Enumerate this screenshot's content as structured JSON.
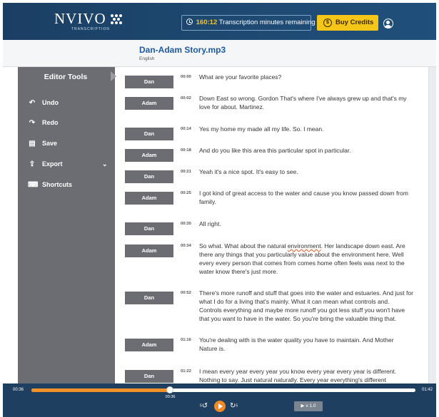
{
  "header": {
    "logo_text": "NVIVO",
    "logo_sub": "TRANSCRIPTION",
    "minutes_value": "160:12",
    "minutes_label": "Transcription minutes remaining",
    "buy_label": "Buy Credits"
  },
  "file": {
    "name": "Dan-Adam Story.mp3",
    "language": "English"
  },
  "sidebar": {
    "title": "Editor Tools",
    "tools": [
      {
        "label": "Undo",
        "icon": "undo-icon",
        "glyph": "↶"
      },
      {
        "label": "Redo",
        "icon": "redo-icon",
        "glyph": "↷"
      },
      {
        "label": "Save",
        "icon": "save-icon",
        "glyph": "▤"
      },
      {
        "label": "Export",
        "icon": "export-icon",
        "glyph": "⇪"
      },
      {
        "label": "Shortcuts",
        "icon": "keyboard-icon",
        "glyph": "⌨"
      }
    ]
  },
  "transcript": [
    {
      "speaker": "Dan",
      "time": "00:00",
      "text": "What are your favorite places?"
    },
    {
      "speaker": "Adam",
      "time": "00:02",
      "text": "Down East so wrong. Gordon That's where I've always grew up and that's my love for about. Martinez."
    },
    {
      "speaker": "Dan",
      "time": "00:14",
      "text": "Yes my home my made all my life. So. I mean."
    },
    {
      "speaker": "Adam",
      "time": "00:18",
      "text": "And do you like this area this particular spot in particular."
    },
    {
      "speaker": "Dan",
      "time": "00:21",
      "text": "Yeah it's a nice spot. It's easy to see."
    },
    {
      "speaker": "Adam",
      "time": "00:25",
      "text": "I got kind of great access to the water and cause you know passed down from family."
    },
    {
      "speaker": "Dan",
      "time": "00:30",
      "text": "All right."
    },
    {
      "speaker": "Adam",
      "time": "00:34",
      "text_before": "So what. What about the natural ",
      "text_flag": "environment",
      "text_after": ". Her landscape down east. Are there any things that you particularly value about the environment here. Well every every person that comes from comes home often feels was next to the water know there's just more."
    },
    {
      "speaker": "Dan",
      "time": "00:52",
      "text": "There's more runoff and stuff that goes into the water and estuaries. And just for what I do for a living that's mainly. What it can mean what controls and. Controls everything and maybe more runoff you got less stuff you won't have that you want to have in the water. So you're bring the valuable thing that."
    },
    {
      "speaker": "Adam",
      "time": "01:16",
      "text": "You're dealing with is the water quality you have to maintain. And Mother Nature is."
    },
    {
      "speaker": "Dan",
      "time": "01:22",
      "text": "I mean every year every year you know every year every year is different. Nothing to say. Just natural naturally. Every year everything's different"
    }
  ],
  "player": {
    "current_time": "00:36",
    "end_time": "01:42",
    "knob_time": "00:36",
    "progress": 0.36,
    "rewind_label": "5",
    "forward_label": "5",
    "speed_label": "x 1.0"
  }
}
